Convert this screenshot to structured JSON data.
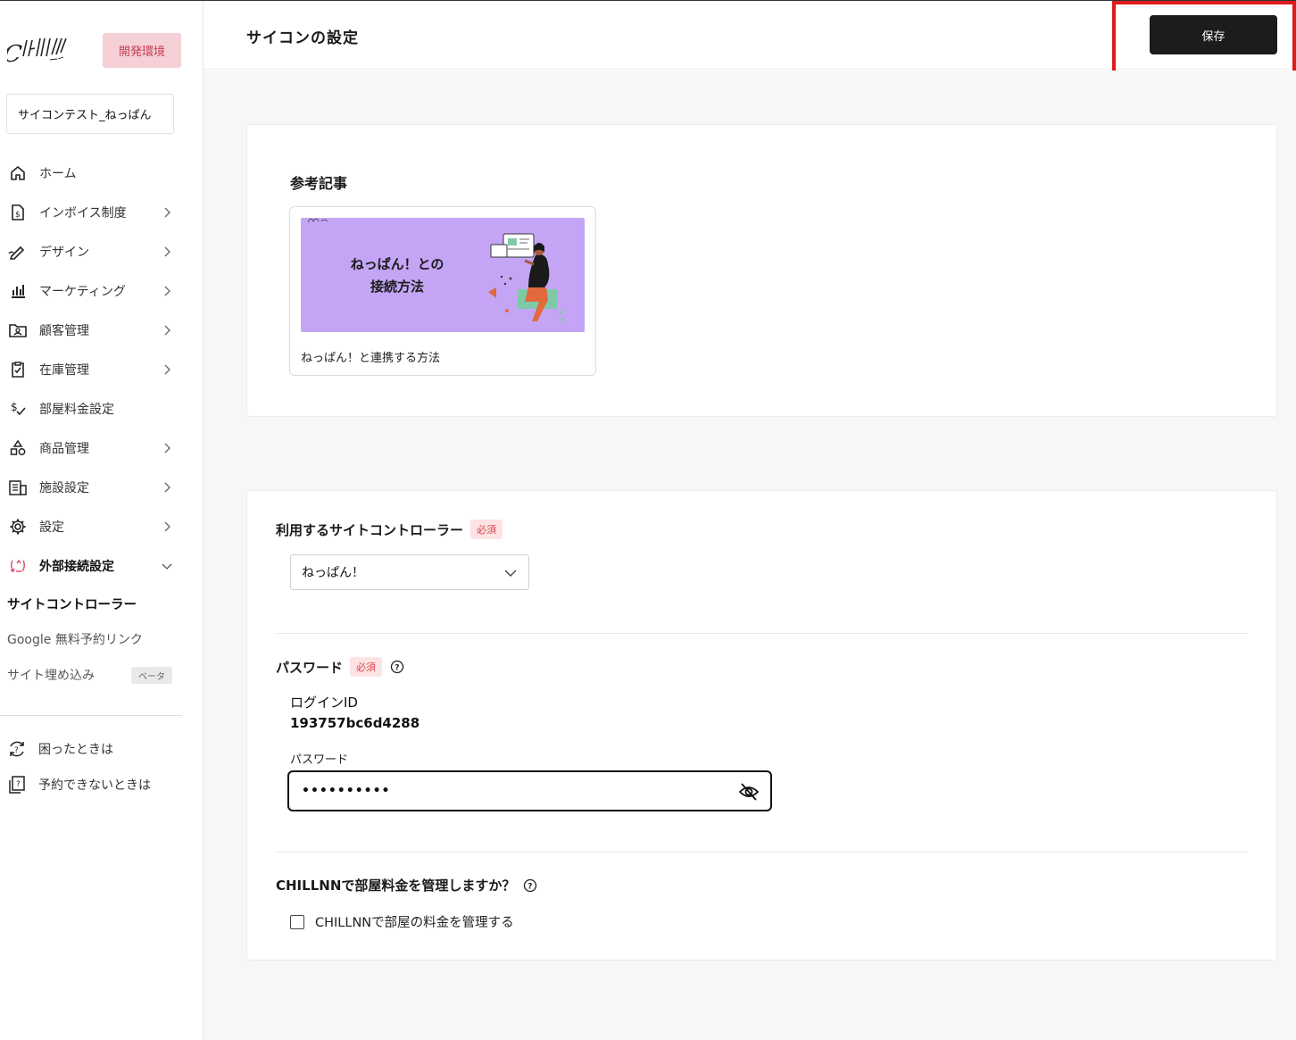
{
  "sidebar": {
    "logo_text": "CHILLNN",
    "env_badge": "開発環境",
    "store_name": "サイコンテスト_ねっぱん",
    "nav": [
      {
        "label": "ホーム"
      },
      {
        "label": "インボイス制度"
      },
      {
        "label": "デザイン"
      },
      {
        "label": "マーケティング"
      },
      {
        "label": "顧客管理"
      },
      {
        "label": "在庫管理"
      },
      {
        "label": "部屋料金設定"
      },
      {
        "label": "商品管理"
      },
      {
        "label": "施設設定"
      },
      {
        "label": "設定"
      },
      {
        "label": "外部接続設定"
      }
    ],
    "sub_items": [
      {
        "label": "サイトコントローラー"
      },
      {
        "label": "Google 無料予約リンク"
      },
      {
        "label": "サイト埋め込み",
        "badge": "ベータ"
      }
    ],
    "help": [
      {
        "label": "困ったときは"
      },
      {
        "label": "予約できないときは"
      }
    ]
  },
  "header": {
    "title": "サイコンの設定",
    "save_label": "保存"
  },
  "reference": {
    "title": "参考記事",
    "thumb_line1": "ねっぱん！との",
    "thumb_line2": "接続方法",
    "caption": "ねっぱん！と連携する方法"
  },
  "form": {
    "controller_label": "利用するサイトコントローラー",
    "required": "必須",
    "controller_value": "ねっぱん！",
    "password_section": "パスワード",
    "login_id_label": "ログインID",
    "login_id_value": "193757bc6d4288",
    "password_label": "パスワード",
    "password_value": "••••••••••",
    "manage_question": "CHILLNNで部屋料金を管理しますか？",
    "manage_checkbox": "CHILLNNで部屋の料金を管理する",
    "manage_checked": false
  },
  "colors": {
    "accent_red": "#e01b1b",
    "badge_pink": "#f5d0d6",
    "save_bg": "#1c1c1c",
    "thumb_purple": "#c4a5f5"
  }
}
